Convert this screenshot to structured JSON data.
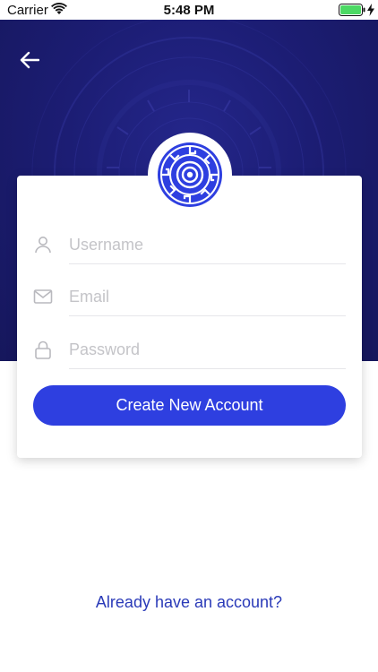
{
  "status_bar": {
    "carrier": "Carrier",
    "time": "5:48 PM"
  },
  "colors": {
    "hero": "#1c1d74",
    "accent": "#2e3fe0",
    "link": "#2a3ab8",
    "battery": "#4cd964"
  },
  "icons": {
    "back": "arrow-left-icon",
    "logo": "greek-key-emblem",
    "username": "user-icon",
    "email": "mail-icon",
    "password": "lock-icon"
  },
  "form": {
    "username_placeholder": "Username",
    "email_placeholder": "Email",
    "password_placeholder": "Password",
    "username_value": "",
    "email_value": "",
    "password_value": "",
    "submit_label": "Create New Account"
  },
  "footer": {
    "login_link": "Already have an account?"
  }
}
